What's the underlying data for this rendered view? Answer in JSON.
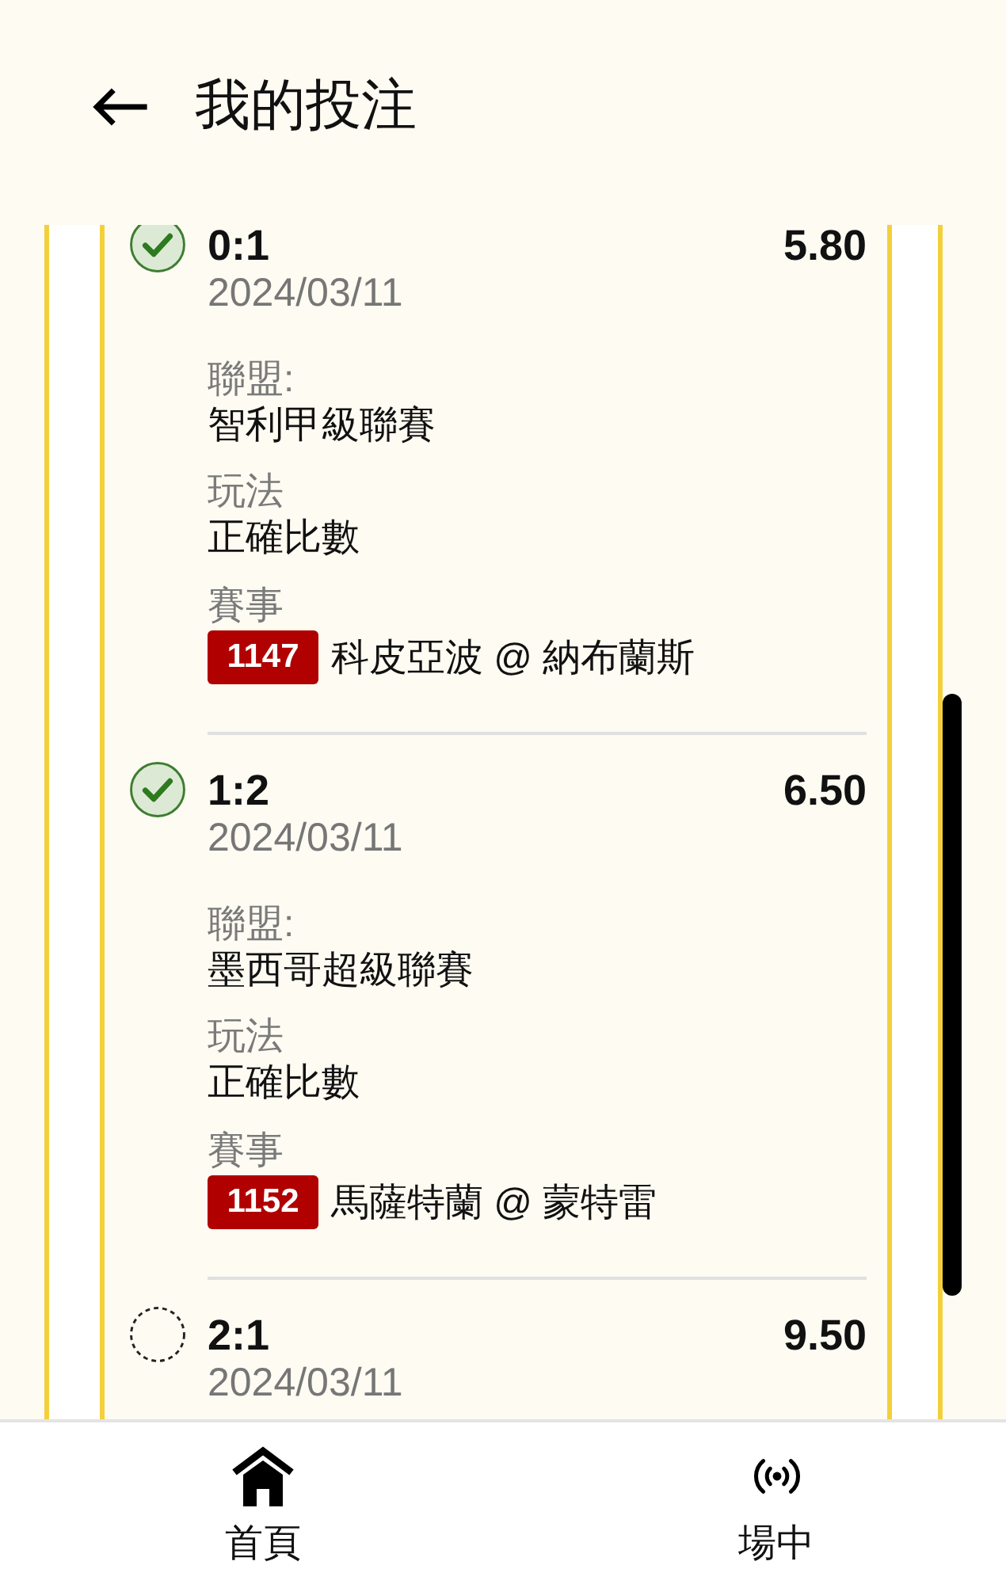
{
  "header": {
    "title": "我的投注"
  },
  "bets": [
    {
      "checked": true,
      "score": "0:1",
      "odds": "5.80",
      "date": "2024/03/11",
      "fields": [
        {
          "label": "聯盟:",
          "value": "智利甲級聯賽"
        },
        {
          "label": "玩法",
          "value": "正確比數"
        }
      ],
      "match": {
        "label": "賽事",
        "code": "1147",
        "teams": "科皮亞波 @ 納布蘭斯"
      }
    },
    {
      "checked": true,
      "score": "1:2",
      "odds": "6.50",
      "date": "2024/03/11",
      "fields": [
        {
          "label": "聯盟:",
          "value": "墨西哥超級聯賽"
        },
        {
          "label": "玩法",
          "value": "正確比數"
        }
      ],
      "match": {
        "label": "賽事",
        "code": "1152",
        "teams": "馬薩特蘭 @ 蒙特雷"
      }
    },
    {
      "checked": false,
      "score": "2:1",
      "odds": "9.50",
      "date": "2024/03/11"
    }
  ],
  "bottom_nav": [
    {
      "kind": "home",
      "label": "首頁"
    },
    {
      "kind": "live",
      "label": "場中"
    }
  ]
}
